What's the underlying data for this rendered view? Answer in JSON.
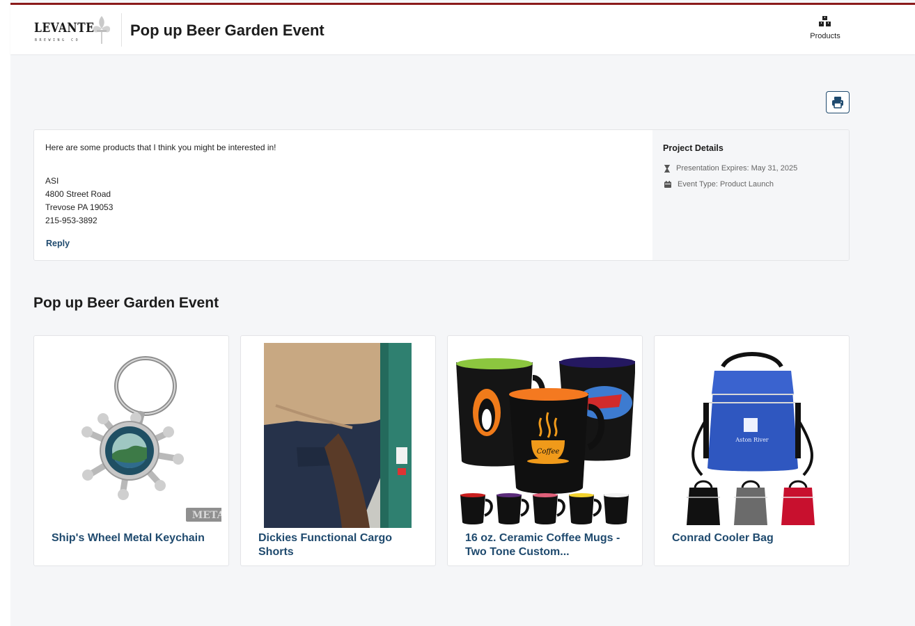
{
  "header": {
    "logo_word": "LEVANTE",
    "logo_sub": "BREWING CO",
    "title": "Pop up Beer Garden Event",
    "products_label": "Products"
  },
  "intro": {
    "message": "Here are some products that I think you might be interested in!",
    "address_lines": [
      "ASI",
      "4800 Street Road",
      "Trevose PA 19053",
      "215-953-3892"
    ],
    "reply_label": "Reply"
  },
  "project_details": {
    "heading": "Project Details",
    "expires": "Presentation Expires: May 31, 2025",
    "event_type": "Event Type: Product Launch"
  },
  "section_title": "Pop up Beer Garden Event",
  "products": [
    {
      "name": "Ship's Wheel Metal Keychain",
      "badge": "METAL",
      "image_icon": "keychain-image"
    },
    {
      "name": "Dickies Functional Cargo Shorts",
      "image_icon": "cargo-shorts-image"
    },
    {
      "name": "16 oz. Ceramic Coffee Mugs - Two Tone Custom...",
      "mug_text": "Coffee",
      "image_icon": "coffee-mugs-image"
    },
    {
      "name": "Conrad Cooler Bag",
      "bag_text": "Aston River",
      "image_icon": "cooler-bag-image"
    }
  ],
  "colors": {
    "accent_line": "#8b1a1a",
    "link": "#1f4a6e",
    "page_bg": "#f5f6f8"
  }
}
